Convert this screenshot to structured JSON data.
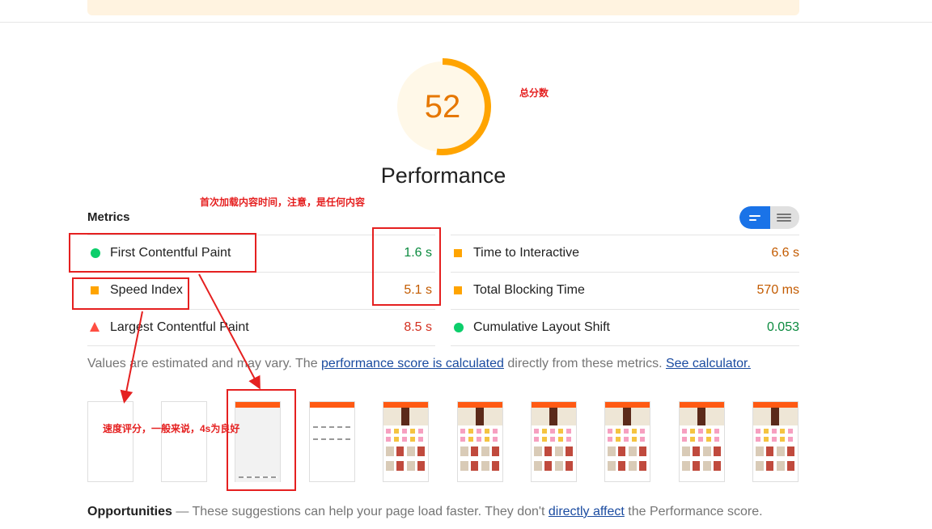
{
  "score": {
    "value": "52",
    "fraction": 0.52,
    "color": "#ffa400"
  },
  "category": {
    "title": "Performance"
  },
  "metrics": {
    "title": "Metrics",
    "items": [
      {
        "label": "First Contentful Paint",
        "value": "1.6 s",
        "status": "pass"
      },
      {
        "label": "Time to Interactive",
        "value": "6.6 s",
        "status": "average"
      },
      {
        "label": "Speed Index",
        "value": "5.1 s",
        "status": "average"
      },
      {
        "label": "Total Blocking Time",
        "value": "570 ms",
        "status": "average"
      },
      {
        "label": "Largest Contentful Paint",
        "value": "8.5 s",
        "status": "fail"
      },
      {
        "label": "Cumulative Layout Shift",
        "value": "0.053",
        "status": "pass"
      }
    ]
  },
  "note": {
    "text1": "Values are estimated and may vary. The ",
    "link1": "performance score is calculated",
    "text2": " directly from these metrics. ",
    "link2": "See calculator."
  },
  "opportunities": {
    "title": "Opportunities",
    "text1": " — These suggestions can help your page load faster. They don't ",
    "link": "directly affect",
    "text2": " the Performance score."
  },
  "annotations": {
    "total_score": "总分数",
    "fcp_note": "首次加载内容时间，注意，是任何内容",
    "speed_index_note": "速度评分，一般来说，4s为良好"
  },
  "colors": {
    "pass": "#0cce6b",
    "average": "#ffa400",
    "fail": "#ff4e42",
    "annotation": "#e52020",
    "toggle": "#1a73e8"
  }
}
